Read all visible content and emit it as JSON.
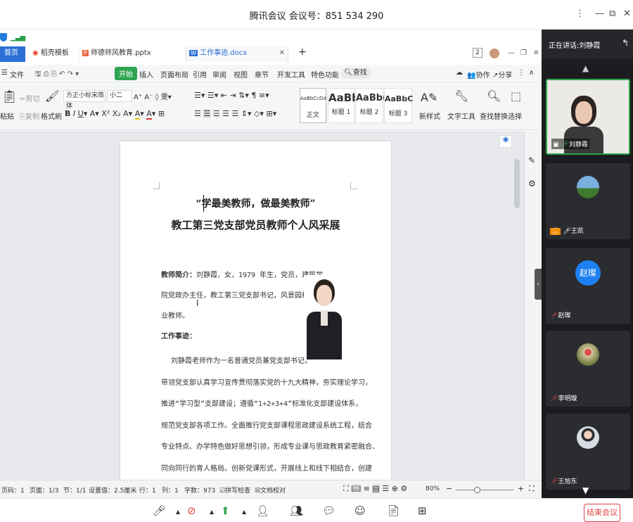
{
  "meeting": {
    "title": "腾讯会议 会议号：851 534 290",
    "speaking_label": "正在讲话:",
    "speaking_name": "刘静霞",
    "end_label": "结束会议"
  },
  "tabs": [
    {
      "label": "首页"
    },
    {
      "label": "稻壳模板"
    },
    {
      "label": "师德师风教育.pptx"
    },
    {
      "label": "工作事迹.docx"
    }
  ],
  "tab_count": "2",
  "ribbon_tabs": [
    "文件",
    "开始",
    "插入",
    "页面布局",
    "引用",
    "审阅",
    "视图",
    "章节",
    "开发工具",
    "特色功能",
    "查找"
  ],
  "ribbon_right": {
    "collab": "协作",
    "share": "分享"
  },
  "ribbon": {
    "paste": "粘贴",
    "cut": "剪切",
    "copy": "复制",
    "format_painter": "格式刷",
    "font_name": "方正小标宋简体",
    "font_size": "小二",
    "new_style": "新样式",
    "text_tool": "文字工具",
    "find_replace": "查找替换",
    "select": "选择"
  },
  "styles": [
    {
      "preview": "AaBbCcDd",
      "name": "正文"
    },
    {
      "preview": "AaBb",
      "name": "标题 1"
    },
    {
      "preview": "AaBb(",
      "name": "标题 2"
    },
    {
      "preview": "AaBbC",
      "name": "标题 3"
    }
  ],
  "document": {
    "title1": "“学最美教师，做最美教师”",
    "title2": "教工第三党支部党员教师个人风采展",
    "intro_label": "教师简介：",
    "intro_lines": [
      "刘静霞，女，1979 年生，党员，建筑学",
      "院党政办主任，教工第三党支部书记，风景园林专",
      "业教师。"
    ],
    "work_label": "工作事迹：",
    "body_lines": [
      "刘静霞老师作为一名普通党员兼党支部书记，",
      "带领党支部认真学习宣传贯彻落实党的十九大精神，夯实理论学习，",
      "推进“学习型”支部建设；遵循“1+2+3+4”标准化支部建设体系，",
      "规范党支部各项工作。全面推行党支部课程思政建设系统工程，结合",
      "专业特点、办学特色做好思想引领，形成专业课与思政教育紧密融合、",
      "同向同行的育人格局。创新党课形式，开展线上和线下相结合，创建"
    ]
  },
  "status": {
    "page_num": "页码：1",
    "pages": "页面：1/3",
    "section": "节：1/1",
    "setting": "设置值：2.5厘米",
    "row": "行：1",
    "col": "列：1",
    "words": "字数：973",
    "spell": "拼写检查",
    "proof": "文档校对",
    "zoom": "80%"
  },
  "participants": [
    {
      "name": "刘静霞"
    },
    {
      "name": "王凯"
    },
    {
      "name": "赵璨",
      "avatar_text": "赵璨"
    },
    {
      "name": "李明璇"
    },
    {
      "name": "王旭东"
    }
  ]
}
